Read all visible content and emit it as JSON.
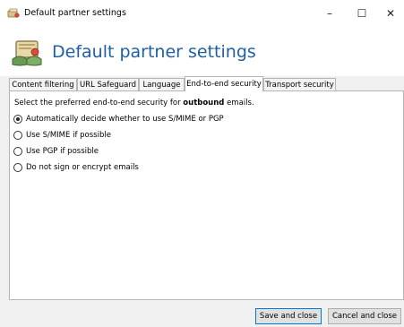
{
  "window": {
    "title": "Default partner settings",
    "controls": {
      "minimize": "–",
      "maximize": "☐",
      "close": "✕"
    }
  },
  "header": {
    "title": "Default partner settings",
    "icon": "partner-handshake-icon"
  },
  "tabs": [
    {
      "label": "Content filtering",
      "active": false
    },
    {
      "label": "URL Safeguard",
      "active": false
    },
    {
      "label": "Language",
      "active": false
    },
    {
      "label": "End-to-end security",
      "active": true
    },
    {
      "label": "Transport security",
      "active": false
    }
  ],
  "panel": {
    "description_prefix": "Select the preferred end-to-end security for ",
    "description_bold": "outbound",
    "description_suffix": " emails.",
    "options": [
      {
        "label": "Automatically decide whether to use S/MIME or PGP",
        "checked": true
      },
      {
        "label": "Use S/MIME if possible",
        "checked": false
      },
      {
        "label": "Use PGP if possible",
        "checked": false
      },
      {
        "label": "Do not sign or encrypt emails",
        "checked": false
      }
    ]
  },
  "footer": {
    "save_label": "Save and close",
    "cancel_label": "Cancel and close"
  },
  "colors": {
    "title_blue": "#1e5fa6",
    "focus_border": "#0078d7"
  }
}
